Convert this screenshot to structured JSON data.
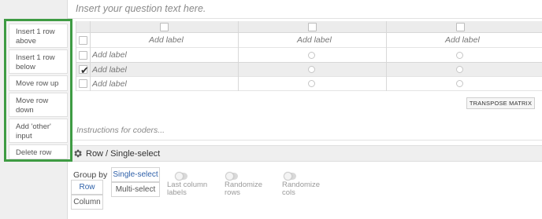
{
  "question": {
    "placeholder": "Insert your question text here."
  },
  "matrix": {
    "column_add_label": "Add label",
    "row_add_label": "Add label",
    "rows": [
      {
        "label": "Add label",
        "checked": false
      },
      {
        "label": "Add label",
        "checked": true
      },
      {
        "label": "Add label",
        "checked": false
      }
    ],
    "check_glyph": "✔",
    "transpose_label": "TRANSPOSE MATRIX"
  },
  "instructions": {
    "placeholder": "Instructions for coders..."
  },
  "section": {
    "title": "Row / Single-select",
    "icon": "gear-icon"
  },
  "options": {
    "group_by_label": "Group by",
    "group_row": "Row",
    "group_column": "Column",
    "single_select": "Single-select",
    "multi_select": "Multi-select",
    "toggles": [
      {
        "label": "Last column labels",
        "on": false
      },
      {
        "label": "Randomize rows",
        "on": false
      },
      {
        "label": "Randomize cols",
        "on": false
      }
    ]
  },
  "context_menu": {
    "items": [
      "Insert 1 row above",
      "Insert 1 row below",
      "Move row up",
      "Move row down",
      "Add 'other' input",
      "Delete row"
    ]
  },
  "colors": {
    "menu_border": "#3e9b43",
    "selected_text": "#2d5fa8"
  }
}
